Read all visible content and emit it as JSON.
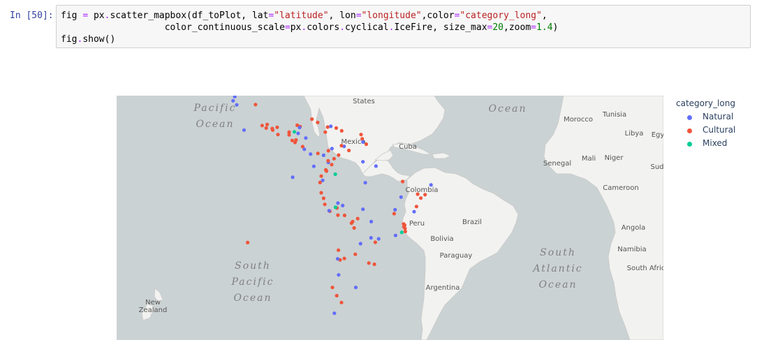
{
  "cell": {
    "prompt": "In [50]:",
    "code": {
      "line1": [
        {
          "t": "fig ",
          "c": ""
        },
        {
          "t": "=",
          "c": "op"
        },
        {
          "t": " px",
          "c": ""
        },
        {
          "t": ".",
          "c": "op"
        },
        {
          "t": "scatter_mapbox(df_toPlot, lat",
          "c": ""
        },
        {
          "t": "=",
          "c": "op"
        },
        {
          "t": "\"latitude\"",
          "c": "str"
        },
        {
          "t": ", lon",
          "c": ""
        },
        {
          "t": "=",
          "c": "op"
        },
        {
          "t": "\"longitude\"",
          "c": "str"
        },
        {
          "t": ",color",
          "c": ""
        },
        {
          "t": "=",
          "c": "op"
        },
        {
          "t": "\"category_long\"",
          "c": "str"
        },
        {
          "t": ",",
          "c": ""
        }
      ],
      "line2": [
        {
          "t": "                   color_continuous_scale",
          "c": ""
        },
        {
          "t": "=",
          "c": "op"
        },
        {
          "t": "px",
          "c": ""
        },
        {
          "t": ".",
          "c": "op"
        },
        {
          "t": "colors",
          "c": ""
        },
        {
          "t": ".",
          "c": "op"
        },
        {
          "t": "cyclical",
          "c": ""
        },
        {
          "t": ".",
          "c": "op"
        },
        {
          "t": "IceFire, size_max",
          "c": ""
        },
        {
          "t": "=",
          "c": "op"
        },
        {
          "t": "20",
          "c": "num"
        },
        {
          "t": ",zoom",
          "c": ""
        },
        {
          "t": "=",
          "c": "op"
        },
        {
          "t": "1.4",
          "c": "num"
        },
        {
          "t": ")",
          "c": ""
        }
      ],
      "line3": [
        {
          "t": "fig",
          "c": ""
        },
        {
          "t": ".",
          "c": "op"
        },
        {
          "t": "show()",
          "c": ""
        }
      ]
    }
  },
  "legend": {
    "title": "category_long",
    "items": [
      {
        "label": "Natural",
        "color": "#636efa"
      },
      {
        "label": "Cultural",
        "color": "#ef553b"
      },
      {
        "label": "Mixed",
        "color": "#00cc96"
      }
    ]
  },
  "colors": {
    "ocean": "#cbd2d3",
    "land": "#f2f2f0",
    "border": "#c9c9c9",
    "label": "#555555",
    "ocean_label": "#808080"
  },
  "map": {
    "labels": {
      "united_states": "United\nStates",
      "mexico": "Mexico",
      "cuba": "Cuba",
      "colombia": "Colombia",
      "brazil": "Brazil",
      "peru": "Peru",
      "bolivia": "Bolivia",
      "paraguay": "Paraguay",
      "argentina": "Argentina",
      "morocco": "Morocco",
      "tunisia": "Tunisia",
      "libya": "Libya",
      "egypt": "Egy",
      "senegal": "Senegal",
      "mali": "Mali",
      "niger": "Niger",
      "sudan": "Sud",
      "cameroon": "Cameroon",
      "angola": "Angola",
      "namibia": "Namibia",
      "south_africa": "South Afric",
      "new_zealand": "New\nZealand",
      "pacific_ocean": "Pacific\nOcean",
      "atlantic_ocean": "Atlantic\nOcean",
      "south_pacific_ocean": "South\nPacific\nOcean",
      "south_atlantic_ocean": "South\nAtlantic\nOcean"
    },
    "points": [
      {
        "c": "Natural",
        "lat": 37.7,
        "lon": -119.5
      },
      {
        "c": "Natural",
        "lat": 31.5,
        "lon": -114.8
      },
      {
        "c": "Natural",
        "lat": 30.0,
        "lon": -115.5
      },
      {
        "c": "Natural",
        "lat": 18.8,
        "lon": -110.9
      },
      {
        "c": "Natural",
        "lat": 28.5,
        "lon": -114.0
      },
      {
        "c": "Cultural",
        "lat": 28.6,
        "lon": -106.1
      },
      {
        "c": "Cultural",
        "lat": 19.4,
        "lon": -99.1
      },
      {
        "c": "Cultural",
        "lat": 21.0,
        "lon": -101.2
      },
      {
        "c": "Cultural",
        "lat": 19.9,
        "lon": -97.0
      },
      {
        "c": "Cultural",
        "lat": 18.8,
        "lon": -98.9
      },
      {
        "c": "Cultural",
        "lat": 20.6,
        "lon": -103.3
      },
      {
        "c": "Cultural",
        "lat": 19.6,
        "lon": -101.6
      },
      {
        "c": "Cultural",
        "lat": 17.0,
        "lon": -96.7
      },
      {
        "c": "Cultural",
        "lat": 20.7,
        "lon": -88.6
      },
      {
        "c": "Cultural",
        "lat": 20.2,
        "lon": -87.4
      },
      {
        "c": "Cultural",
        "lat": 18.0,
        "lon": -92.0
      },
      {
        "c": "Mixed",
        "lat": 18.1,
        "lon": -89.8
      },
      {
        "c": "Cultural",
        "lat": 16.9,
        "lon": -92.0
      },
      {
        "c": "Natural",
        "lat": 19.8,
        "lon": -87.6
      },
      {
        "c": "Cultural",
        "lat": 14.6,
        "lon": -90.7
      },
      {
        "c": "Cultural",
        "lat": 14.8,
        "lon": -89.1
      },
      {
        "c": "Natural",
        "lat": 15.6,
        "lon": -85.0
      },
      {
        "c": "Cultural",
        "lat": 13.8,
        "lon": -89.5
      },
      {
        "c": "Cultural",
        "lat": 12.1,
        "lon": -86.3
      },
      {
        "c": "Natural",
        "lat": 11.0,
        "lon": -85.6
      },
      {
        "c": "Natural",
        "lat": 9.0,
        "lon": -83.0
      },
      {
        "c": "Cultural",
        "lat": 9.3,
        "lon": -79.9
      },
      {
        "c": "Natural",
        "lat": 8.5,
        "lon": -77.5
      },
      {
        "c": "Cultural",
        "lat": 23.1,
        "lon": -82.4
      },
      {
        "c": "Cultural",
        "lat": 21.8,
        "lon": -80.0
      },
      {
        "c": "Cultural",
        "lat": 20.0,
        "lon": -75.8
      },
      {
        "c": "Natural",
        "lat": 20.3,
        "lon": -74.5
      },
      {
        "c": "Cultural",
        "lat": 18.5,
        "lon": -69.9
      },
      {
        "c": "Cultural",
        "lat": 18.0,
        "lon": -76.8
      },
      {
        "c": "Cultural",
        "lat": 19.6,
        "lon": -72.2
      },
      {
        "c": "Natural",
        "lat": 17.5,
        "lon": -88.2
      },
      {
        "c": "Cultural",
        "lat": 17.0,
        "lon": -61.8
      },
      {
        "c": "Cultural",
        "lat": 15.3,
        "lon": -61.3
      },
      {
        "c": "Natural",
        "lat": 14.0,
        "lon": -61.0
      },
      {
        "c": "Cultural",
        "lat": 13.1,
        "lon": -59.6
      },
      {
        "c": "Natural",
        "lat": 12.2,
        "lon": -68.9
      },
      {
        "c": "Cultural",
        "lat": 12.5,
        "lon": -70.0
      },
      {
        "c": "Cultural",
        "lat": 10.4,
        "lon": -75.5
      },
      {
        "c": "Cultural",
        "lat": 10.5,
        "lon": -66.9
      },
      {
        "c": "Natural",
        "lat": 11.3,
        "lon": -74.0
      },
      {
        "c": "Cultural",
        "lat": 7.1,
        "lon": -73.1
      },
      {
        "c": "Cultural",
        "lat": 8.6,
        "lon": -71.2
      },
      {
        "c": "Natural",
        "lat": 5.5,
        "lon": -75.5
      },
      {
        "c": "Cultural",
        "lat": 6.2,
        "lon": -75.6
      },
      {
        "c": "Cultural",
        "lat": 4.6,
        "lon": -74.1
      },
      {
        "c": "Cultural",
        "lat": 2.4,
        "lon": -76.6
      },
      {
        "c": "Cultural",
        "lat": 1.9,
        "lon": -76.3
      },
      {
        "c": "Mixed",
        "lat": 0.6,
        "lon": -72.6
      },
      {
        "c": "Natural",
        "lat": 5.8,
        "lon": -61.0
      },
      {
        "c": "Natural",
        "lat": 4.0,
        "lon": -55.5
      },
      {
        "c": "Natural",
        "lat": 3.9,
        "lon": -81.6
      },
      {
        "c": "Natural",
        "lat": -0.7,
        "lon": -90.5
      },
      {
        "c": "Cultural",
        "lat": -0.2,
        "lon": -78.5
      },
      {
        "c": "Cultural",
        "lat": -2.9,
        "lon": -79.0
      },
      {
        "c": "Natural",
        "lat": -2.0,
        "lon": -77.9
      },
      {
        "c": "Cultural",
        "lat": -7.2,
        "lon": -78.5
      },
      {
        "c": "Cultural",
        "lat": -9.5,
        "lon": -77.5
      },
      {
        "c": "Cultural",
        "lat": -12.0,
        "lon": -77.0
      },
      {
        "c": "Cultural",
        "lat": -13.5,
        "lon": -71.9
      },
      {
        "c": "Mixed",
        "lat": -13.2,
        "lon": -72.5
      },
      {
        "c": "Natural",
        "lat": -12.5,
        "lon": -69.5
      },
      {
        "c": "Natural",
        "lat": -11.5,
        "lon": -71.5
      },
      {
        "c": "Cultural",
        "lat": -14.8,
        "lon": -74.9
      },
      {
        "c": "Cultural",
        "lat": -16.4,
        "lon": -71.5
      },
      {
        "c": "Natural",
        "lat": -14.6,
        "lon": -75.2
      },
      {
        "c": "Cultural",
        "lat": -19.0,
        "lon": -65.3
      },
      {
        "c": "Cultural",
        "lat": -19.6,
        "lon": -65.8
      },
      {
        "c": "Cultural",
        "lat": -17.8,
        "lon": -63.2
      },
      {
        "c": "Natural",
        "lat": -14.0,
        "lon": -61.0
      },
      {
        "c": "Cultural",
        "lat": -16.5,
        "lon": -68.7
      },
      {
        "c": "Cultural",
        "lat": -21.5,
        "lon": -64.7
      },
      {
        "c": "Cultural",
        "lat": -27.0,
        "lon": -55.8
      },
      {
        "c": "Natural",
        "lat": -25.7,
        "lon": -54.4
      },
      {
        "c": "Natural",
        "lat": -25.3,
        "lon": -57.6
      },
      {
        "c": "Cultural",
        "lat": -7.8,
        "lon": -38.0
      },
      {
        "c": "Cultural",
        "lat": -8.0,
        "lon": -34.9
      },
      {
        "c": "Natural",
        "lat": -3.9,
        "lon": -32.4
      },
      {
        "c": "Cultural",
        "lat": -2.5,
        "lon": -44.3
      },
      {
        "c": "Cultural",
        "lat": -9.4,
        "lon": -36.7
      },
      {
        "c": "Cultural",
        "lat": -12.9,
        "lon": -38.5
      },
      {
        "c": "Natural",
        "lat": -15.0,
        "lon": -39.5
      },
      {
        "c": "Cultural",
        "lat": -15.8,
        "lon": -47.9
      },
      {
        "c": "Cultural",
        "lat": -19.9,
        "lon": -43.9
      },
      {
        "c": "Cultural",
        "lat": -20.4,
        "lon": -43.5
      },
      {
        "c": "Cultural",
        "lat": -21.0,
        "lon": -43.8
      },
      {
        "c": "Cultural",
        "lat": -22.9,
        "lon": -43.2
      },
      {
        "c": "Cultural",
        "lat": -21.7,
        "lon": -43.3
      },
      {
        "c": "Natural",
        "lat": -19.0,
        "lon": -57.5
      },
      {
        "c": "Mixed",
        "lat": -23.2,
        "lon": -44.7
      },
      {
        "c": "Natural",
        "lat": -24.4,
        "lon": -47.3
      },
      {
        "c": "Natural",
        "lat": -14.2,
        "lon": -47.5
      },
      {
        "c": "Natural",
        "lat": -3.0,
        "lon": -60.0
      },
      {
        "c": "Natural",
        "lat": -9.0,
        "lon": -45.0
      },
      {
        "c": "Cultural",
        "lat": -27.1,
        "lon": -109.4
      },
      {
        "c": "Natural",
        "lat": -27.5,
        "lon": -62.0
      },
      {
        "c": "Cultural",
        "lat": -31.4,
        "lon": -64.2
      },
      {
        "c": "Cultural",
        "lat": -32.9,
        "lon": -68.8
      },
      {
        "c": "Cultural",
        "lat": -34.5,
        "lon": -58.5
      },
      {
        "c": "Cultural",
        "lat": -34.9,
        "lon": -56.2
      },
      {
        "c": "Cultural",
        "lat": -33.4,
        "lon": -70.6
      },
      {
        "c": "Natural",
        "lat": -33.0,
        "lon": -71.6
      },
      {
        "c": "Cultural",
        "lat": -42.5,
        "lon": -73.8
      },
      {
        "c": "Natural",
        "lat": -42.5,
        "lon": -64.0
      },
      {
        "c": "Cultural",
        "lat": -45.0,
        "lon": -72.0
      },
      {
        "c": "Natural",
        "lat": -50.0,
        "lon": -73.0
      },
      {
        "c": "Cultural",
        "lat": -47.0,
        "lon": -70.0
      },
      {
        "c": "Natural",
        "lat": -38.5,
        "lon": -71.2
      },
      {
        "c": "Cultural",
        "lat": -29.9,
        "lon": -71.3
      }
    ]
  }
}
